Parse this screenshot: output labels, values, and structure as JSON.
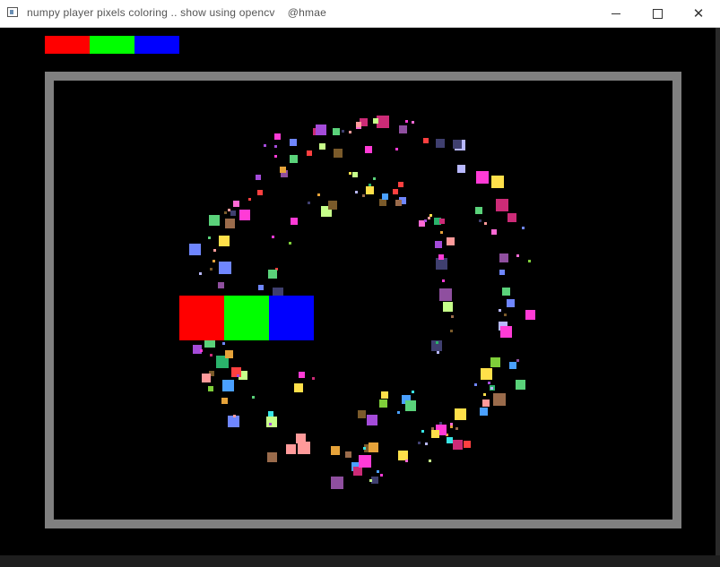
{
  "window": {
    "title": "numpy player pixels coloring .. show using opencv    @hmae",
    "minimize_icon": "minimize-icon",
    "maximize_icon": "maximize-icon",
    "close_icon": "close-icon"
  },
  "colors": {
    "red": "#ff0000",
    "green": "#00ff00",
    "blue": "#0000ff",
    "frame": "#808080",
    "background": "#000000"
  },
  "palette_bar": [
    "#ff0000",
    "#00ff00",
    "#0000ff"
  ],
  "player_pixels": [
    "#ff0000",
    "#00ff00",
    "#0000ff"
  ],
  "particle_colors": [
    "#ff3bd6",
    "#39e6e6",
    "#a44bd9",
    "#7fcf3a",
    "#e6a33a",
    "#9a6b4b",
    "#ff6ad5",
    "#5ad27a",
    "#6f86ff",
    "#ff4040",
    "#2ab36b",
    "#b8b8ff",
    "#3f3f6f",
    "#8f4f9f",
    "#c7ff8a",
    "#ff9a9a",
    "#ffe04a",
    "#cc2b77",
    "#4aa0ff",
    "#7a5a2a"
  ]
}
